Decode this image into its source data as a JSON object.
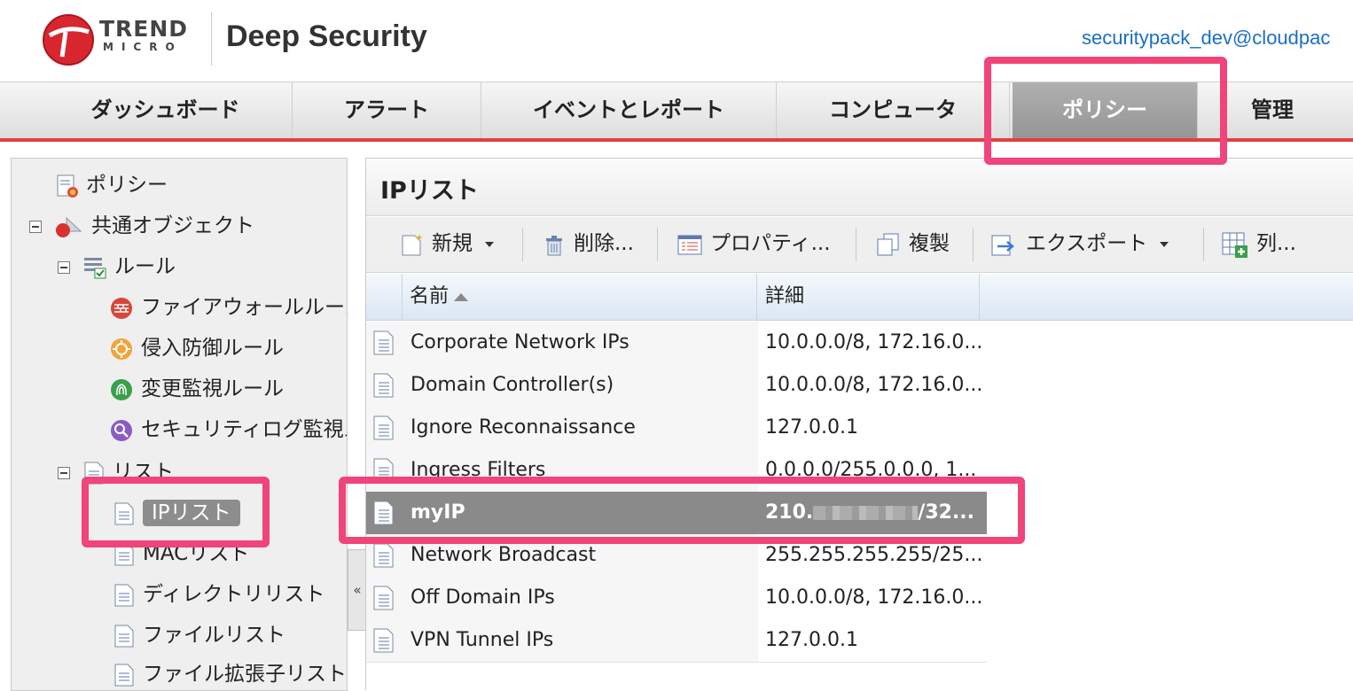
{
  "header": {
    "brand_line1": "TREND",
    "brand_line2": "MICRO",
    "product": "Deep Security",
    "user": "securitypack_dev@cloudpac"
  },
  "nav": {
    "items": [
      {
        "label": "ダッシュボード"
      },
      {
        "label": "アラート"
      },
      {
        "label": "イベントとレポート"
      },
      {
        "label": "コンピュータ"
      },
      {
        "label": "ポリシー",
        "active": true
      },
      {
        "label": "管理"
      }
    ]
  },
  "sidebar": {
    "items": [
      {
        "label": "ポリシー"
      },
      {
        "label": "共通オブジェクト"
      },
      {
        "label": "ルール"
      },
      {
        "label": "ファイアウォールルール"
      },
      {
        "label": "侵入防御ルール"
      },
      {
        "label": "変更監視ルール"
      },
      {
        "label": "セキュリティログ監視ルール"
      },
      {
        "label": "リスト"
      },
      {
        "label": "IPリスト",
        "selected": true
      },
      {
        "label": "MACリスト"
      },
      {
        "label": "ディレクトリリスト"
      },
      {
        "label": "ファイルリスト"
      },
      {
        "label": "ファイル拡張子リスト"
      }
    ],
    "collapse_glyph": "«"
  },
  "main": {
    "title": "IPリスト",
    "toolbar": {
      "new": "新規",
      "delete": "削除...",
      "properties": "プロパティ...",
      "duplicate": "複製",
      "export": "エクスポート",
      "columns": "列..."
    },
    "columns": [
      "名前",
      "詳細"
    ],
    "rows": [
      {
        "name": "Corporate Network IPs",
        "detail": "10.0.0.0/8, 172.16.0..."
      },
      {
        "name": "Domain Controller(s)",
        "detail": "10.0.0.0/8, 172.16.0..."
      },
      {
        "name": "Ignore Reconnaissance",
        "detail": "127.0.0.1"
      },
      {
        "name": "Ingress Filters",
        "detail": "0.0.0.0/255.0.0.0, 1..."
      },
      {
        "name": "myIP",
        "detail_prefix": "210.",
        "detail_suffix": "/32...",
        "selected": true
      },
      {
        "name": "Network Broadcast",
        "detail": "255.255.255.255/25..."
      },
      {
        "name": "Off Domain IPs",
        "detail": "10.0.0.0/8, 172.16.0..."
      },
      {
        "name": "VPN Tunnel IPs",
        "detail": "127.0.0.1"
      }
    ]
  },
  "colors": {
    "accent_red": "#e04040",
    "highlight_pink": "#f0447a",
    "link_blue": "#1a6fc4",
    "selected_gray": "#8a8a8a"
  }
}
